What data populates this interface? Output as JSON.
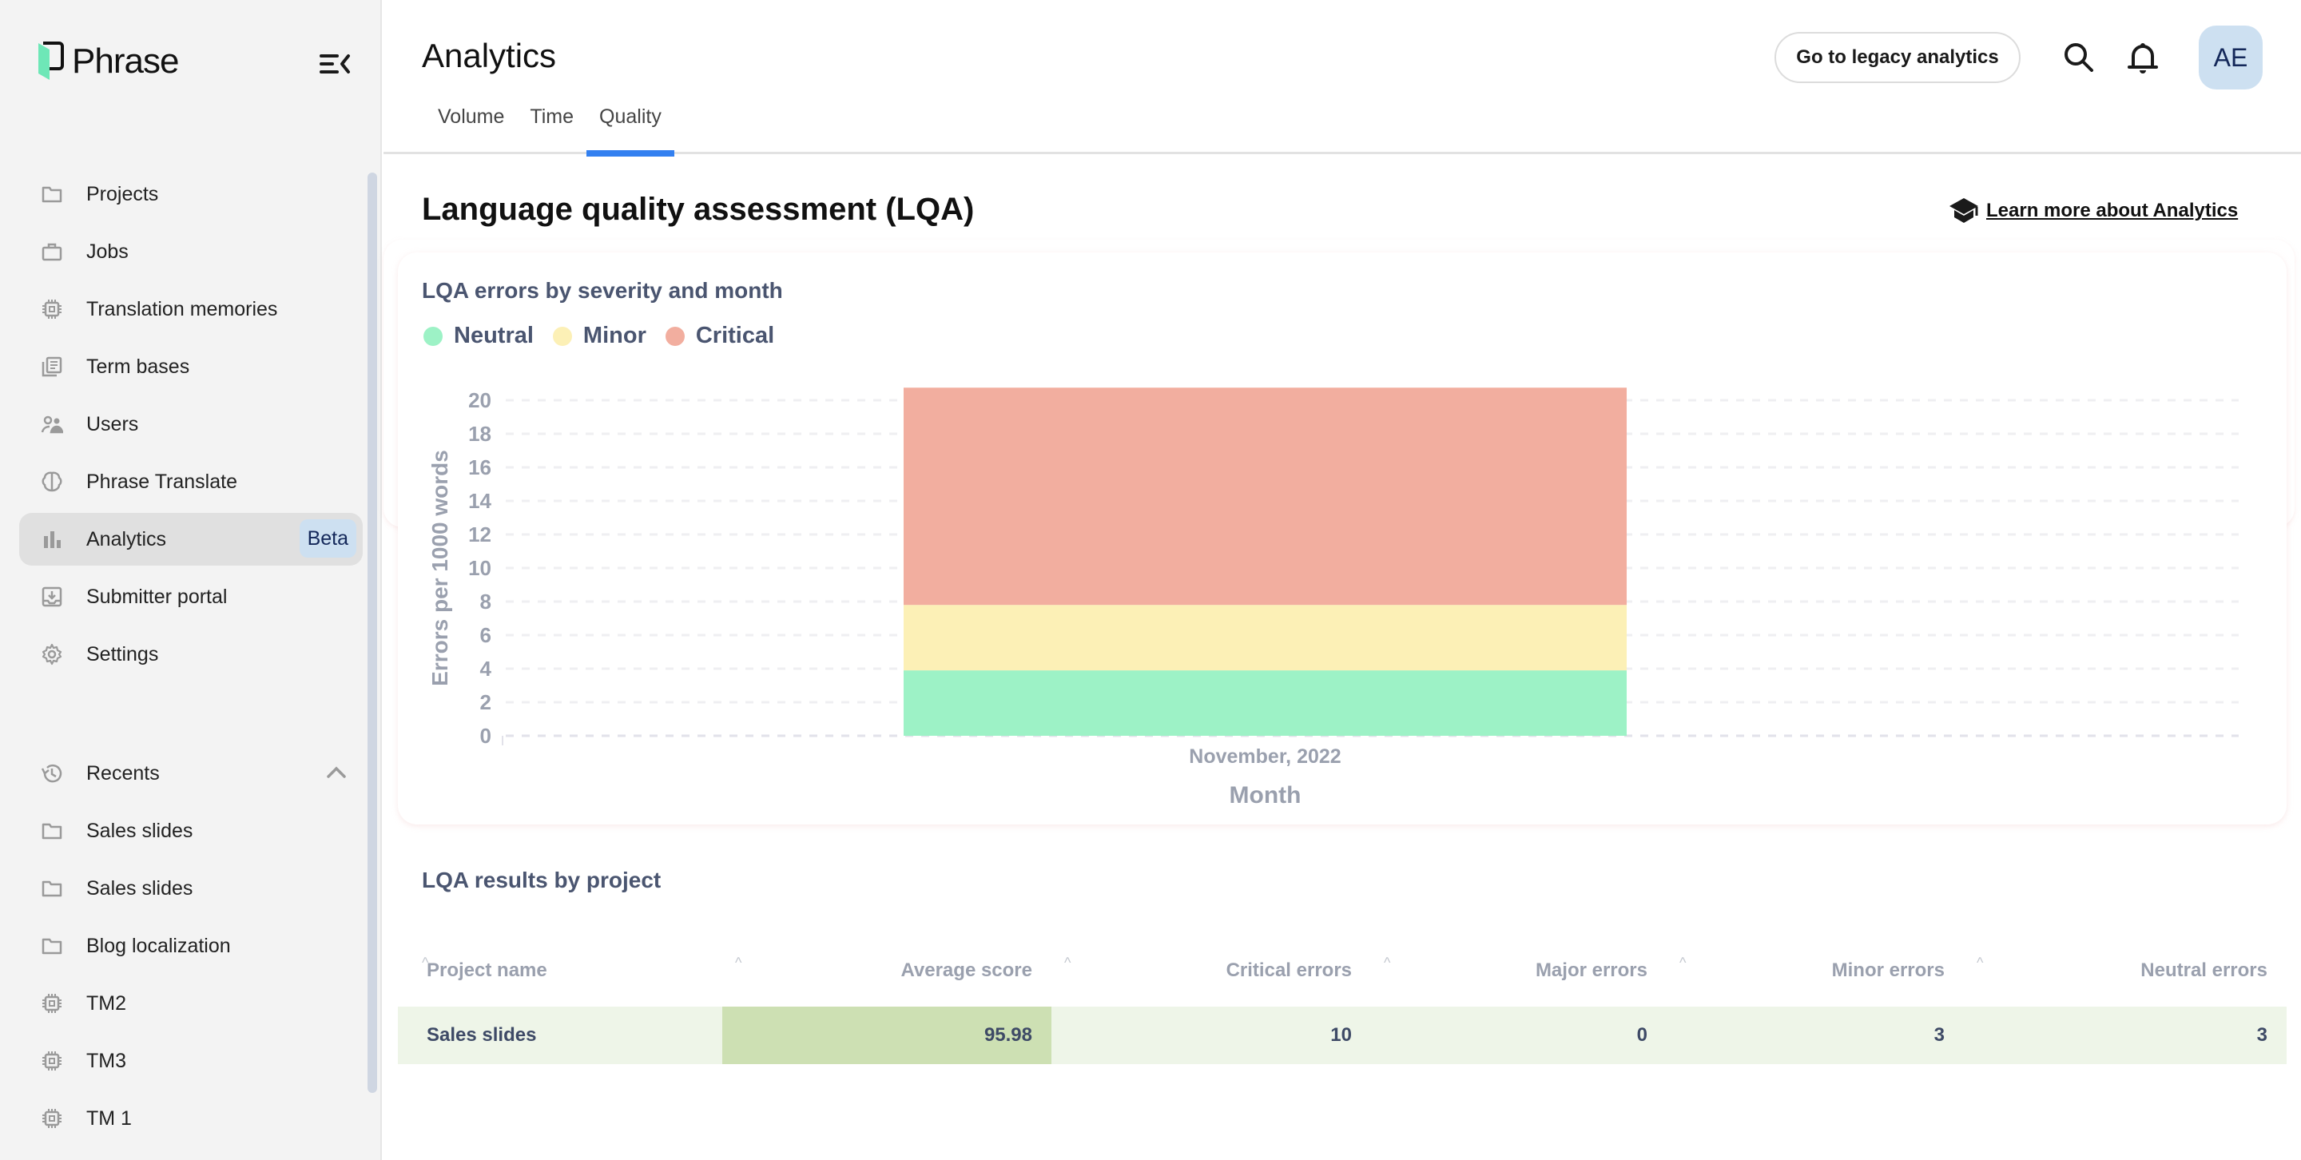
{
  "app": {
    "brand": "Phrase",
    "colors": {
      "accent": "#3380f0",
      "sidebar_bg": "#f3f3f3",
      "badge_bg": "#cde0f1",
      "badge_text": "#14285a"
    }
  },
  "sidebar": {
    "items": [
      {
        "label": "Projects",
        "icon": "folder-icon"
      },
      {
        "label": "Jobs",
        "icon": "briefcase-icon"
      },
      {
        "label": "Translation memories",
        "icon": "chip-icon"
      },
      {
        "label": "Term bases",
        "icon": "term-base-icon"
      },
      {
        "label": "Users",
        "icon": "users-icon"
      },
      {
        "label": "Phrase Translate",
        "icon": "brain-icon"
      },
      {
        "label": "Analytics",
        "icon": "bar-chart-icon",
        "active": true,
        "badge": "Beta"
      },
      {
        "label": "Submitter portal",
        "icon": "inbox-download-icon"
      },
      {
        "label": "Settings",
        "icon": "gear-icon"
      }
    ],
    "recents": {
      "label": "Recents",
      "icon": "history-icon",
      "expanded": true,
      "items": [
        {
          "label": "Sales slides",
          "icon": "folder-icon"
        },
        {
          "label": "Sales slides",
          "icon": "folder-icon"
        },
        {
          "label": "Blog localization",
          "icon": "folder-icon"
        },
        {
          "label": "TM2",
          "icon": "chip-icon"
        },
        {
          "label": "TM3",
          "icon": "chip-icon"
        },
        {
          "label": "TM 1",
          "icon": "chip-icon"
        }
      ]
    }
  },
  "header": {
    "title": "Analytics",
    "tabs": [
      {
        "label": "Volume"
      },
      {
        "label": "Time"
      },
      {
        "label": "Quality",
        "active": true
      }
    ],
    "legacy_button": "Go to legacy analytics",
    "avatar_initials": "AE"
  },
  "main": {
    "section_title": "Language quality assessment (LQA)",
    "learn_more": "Learn more about Analytics",
    "table_title": "LQA results by project",
    "table": {
      "columns": [
        "Project name",
        "Average score",
        "Critical errors",
        "Major errors",
        "Minor errors",
        "Neutral errors"
      ],
      "rows": [
        [
          "Sales slides",
          "95.98",
          "10",
          "0",
          "3",
          "3"
        ]
      ]
    }
  },
  "chart_data": {
    "type": "bar",
    "stacked": true,
    "title": "LQA errors by severity and month",
    "xlabel": "Month",
    "ylabel": "Errors per 1000 words",
    "categories": [
      "November, 2022"
    ],
    "series": [
      {
        "name": "Neutral",
        "color": "#9df2c6",
        "values": [
          3.9
        ]
      },
      {
        "name": "Minor",
        "color": "#fcf0b6",
        "values": [
          3.9
        ]
      },
      {
        "name": "Critical",
        "color": "#f2ae9f",
        "values": [
          12.95
        ]
      }
    ],
    "ylim": [
      0,
      20
    ],
    "yticks": [
      0,
      2,
      4,
      6,
      8,
      10,
      12,
      14,
      16,
      18,
      20
    ],
    "grid": true,
    "legend": "top-left"
  }
}
